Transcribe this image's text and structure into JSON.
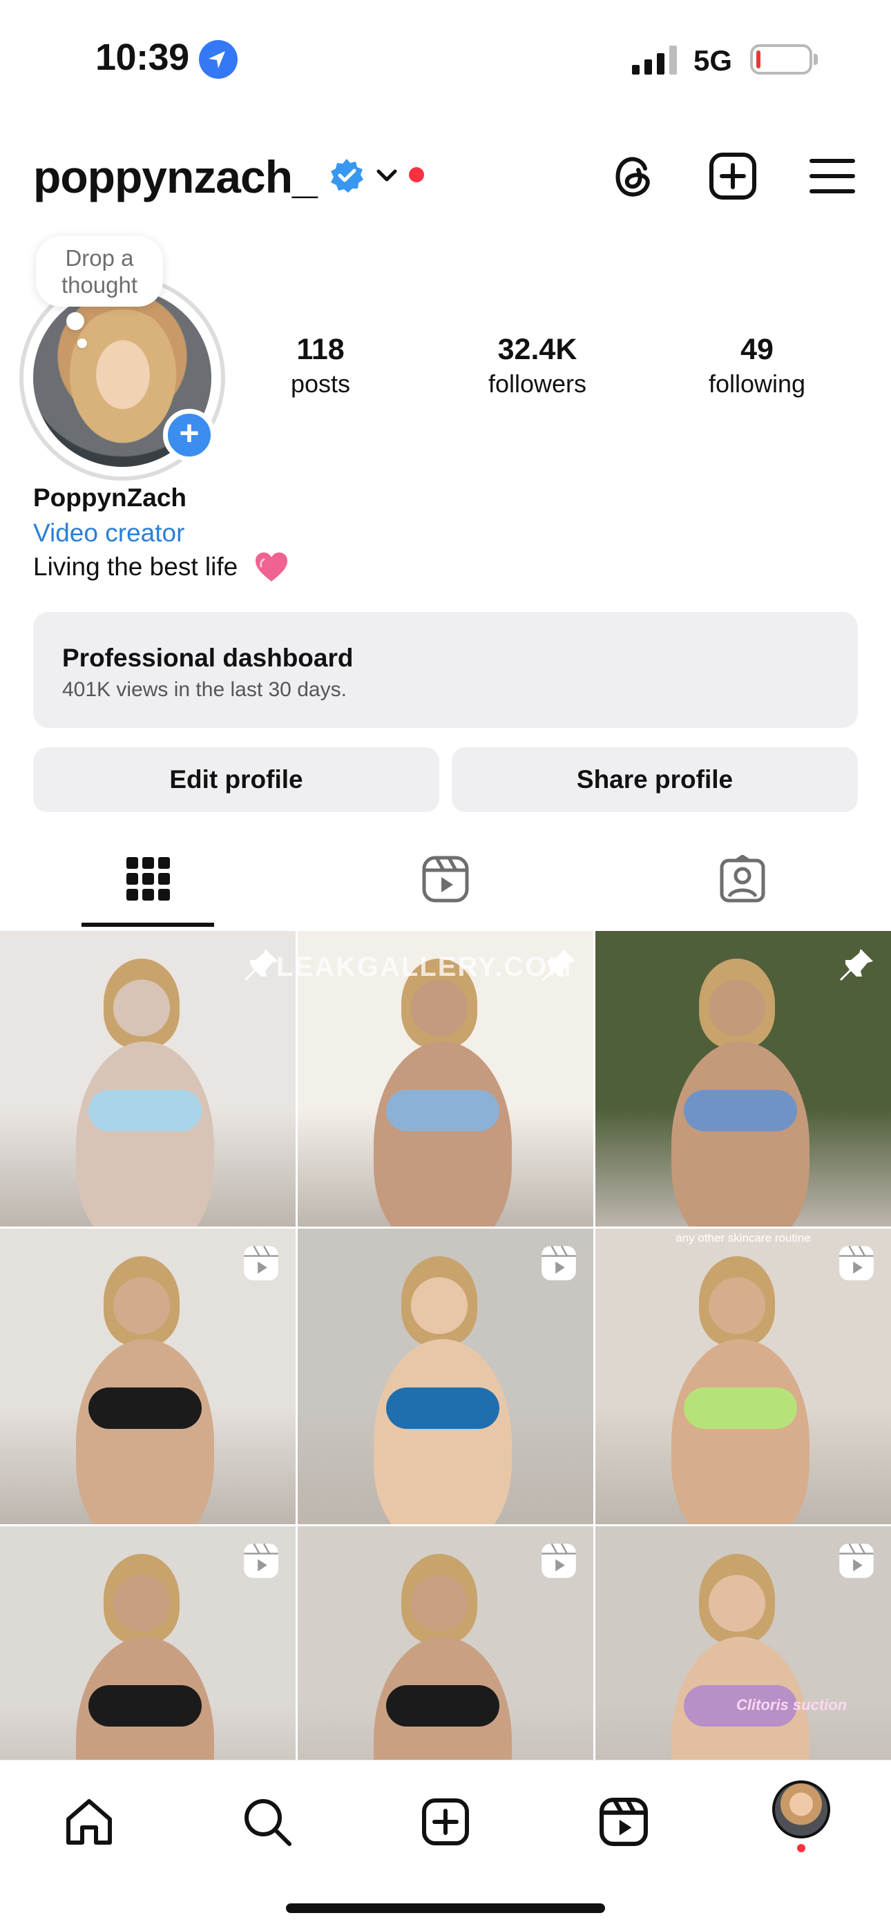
{
  "status_bar": {
    "time": "10:39",
    "network": "5G",
    "battery_level": 0.08,
    "battery_color": "#e53935",
    "location_icon": "location-arrow-icon",
    "signal_icon": "signal-bars-icon"
  },
  "header": {
    "username": "poppynzach_",
    "verified_icon": "verified-badge-icon",
    "verified_color": "#3897f0",
    "dropdown_icon": "chevron-down-icon",
    "notification_dot_color": "#ff3040",
    "actions": [
      {
        "name": "threads-icon"
      },
      {
        "name": "create-post-icon"
      },
      {
        "name": "menu-icon"
      }
    ]
  },
  "profile": {
    "thought_bubble": "Drop a thought",
    "add_story_icon": "plus-icon",
    "stats": [
      {
        "value": "118",
        "label": "posts"
      },
      {
        "value": "32.4K",
        "label": "followers"
      },
      {
        "value": "49",
        "label": "following"
      }
    ],
    "display_name": "PoppynZach",
    "category": "Video creator",
    "category_color": "#2b7fd6",
    "bio": "Living the best life",
    "bio_icon": "pink-heart-icon"
  },
  "dashboard": {
    "title": "Professional dashboard",
    "subtitle": "401K views in the last 30 days."
  },
  "buttons": {
    "edit": "Edit profile",
    "share": "Share profile"
  },
  "tabs": [
    {
      "name": "grid-icon",
      "active": true
    },
    {
      "name": "reels-icon",
      "active": false
    },
    {
      "name": "tagged-icon",
      "active": false
    }
  ],
  "grid": {
    "posts": [
      {
        "overlay": "pin-icon",
        "colors": [
          "#e9e5e2",
          "#d8c4b6",
          "#a8d5ea"
        ]
      },
      {
        "overlay": "pin-icon",
        "colors": [
          "#f3efe9",
          "#c59a7e",
          "#8bb2d6"
        ]
      },
      {
        "overlay": "pin-icon",
        "colors": [
          "#4f5f3a",
          "#c49a7a",
          "#6f93c7"
        ]
      },
      {
        "overlay": "reel-icon",
        "colors": [
          "#e4e0dc",
          "#d2ab8d",
          "#1b1b1b"
        ]
      },
      {
        "overlay": "reel-icon",
        "colors": [
          "#c9c5c0",
          "#e8c7a8",
          "#1f6fb0"
        ]
      },
      {
        "overlay": "reel-icon",
        "colors": [
          "#ded7cf",
          "#d7ad8c",
          "#b6e27a"
        ]
      },
      {
        "overlay": "reel-icon",
        "colors": [
          "#ddd9d5",
          "#c99f82",
          "#1b1b1b"
        ]
      },
      {
        "overlay": "reel-icon",
        "colors": [
          "#d4cfc9",
          "#caa083",
          "#1b1b1b"
        ]
      },
      {
        "overlay": "reel-icon",
        "colors": [
          "#cfcac4",
          "#e3bfa2",
          "#b790c7"
        ]
      }
    ],
    "watermark": "LEAKGALLERY.COM",
    "caption_6": "any other skincare routine",
    "caption_9": "Clitoris suction"
  },
  "bottom_nav": [
    {
      "name": "home-icon"
    },
    {
      "name": "search-icon"
    },
    {
      "name": "create-icon"
    },
    {
      "name": "reels-nav-icon"
    },
    {
      "name": "profile-avatar-icon"
    }
  ]
}
